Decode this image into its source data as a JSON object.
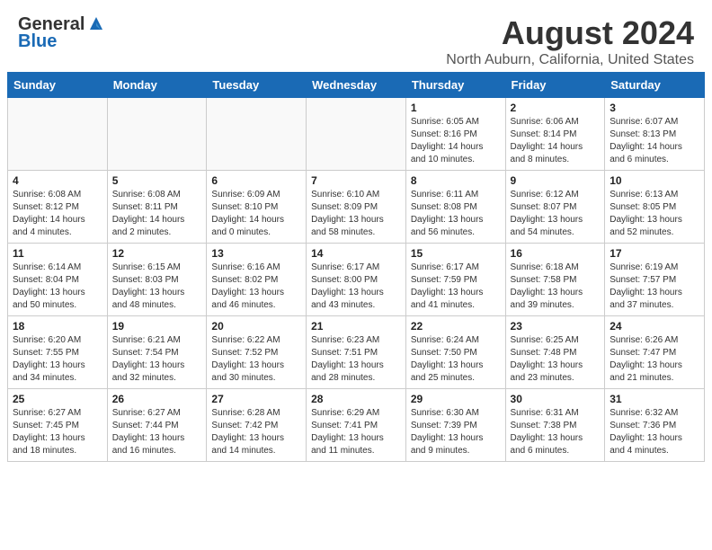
{
  "header": {
    "logo_line1": "General",
    "logo_line2": "Blue",
    "title": "August 2024",
    "subtitle": "North Auburn, California, United States"
  },
  "calendar": {
    "days_of_week": [
      "Sunday",
      "Monday",
      "Tuesday",
      "Wednesday",
      "Thursday",
      "Friday",
      "Saturday"
    ],
    "weeks": [
      [
        {
          "day": "",
          "info": ""
        },
        {
          "day": "",
          "info": ""
        },
        {
          "day": "",
          "info": ""
        },
        {
          "day": "",
          "info": ""
        },
        {
          "day": "1",
          "info": "Sunrise: 6:05 AM\nSunset: 8:16 PM\nDaylight: 14 hours\nand 10 minutes."
        },
        {
          "day": "2",
          "info": "Sunrise: 6:06 AM\nSunset: 8:14 PM\nDaylight: 14 hours\nand 8 minutes."
        },
        {
          "day": "3",
          "info": "Sunrise: 6:07 AM\nSunset: 8:13 PM\nDaylight: 14 hours\nand 6 minutes."
        }
      ],
      [
        {
          "day": "4",
          "info": "Sunrise: 6:08 AM\nSunset: 8:12 PM\nDaylight: 14 hours\nand 4 minutes."
        },
        {
          "day": "5",
          "info": "Sunrise: 6:08 AM\nSunset: 8:11 PM\nDaylight: 14 hours\nand 2 minutes."
        },
        {
          "day": "6",
          "info": "Sunrise: 6:09 AM\nSunset: 8:10 PM\nDaylight: 14 hours\nand 0 minutes."
        },
        {
          "day": "7",
          "info": "Sunrise: 6:10 AM\nSunset: 8:09 PM\nDaylight: 13 hours\nand 58 minutes."
        },
        {
          "day": "8",
          "info": "Sunrise: 6:11 AM\nSunset: 8:08 PM\nDaylight: 13 hours\nand 56 minutes."
        },
        {
          "day": "9",
          "info": "Sunrise: 6:12 AM\nSunset: 8:07 PM\nDaylight: 13 hours\nand 54 minutes."
        },
        {
          "day": "10",
          "info": "Sunrise: 6:13 AM\nSunset: 8:05 PM\nDaylight: 13 hours\nand 52 minutes."
        }
      ],
      [
        {
          "day": "11",
          "info": "Sunrise: 6:14 AM\nSunset: 8:04 PM\nDaylight: 13 hours\nand 50 minutes."
        },
        {
          "day": "12",
          "info": "Sunrise: 6:15 AM\nSunset: 8:03 PM\nDaylight: 13 hours\nand 48 minutes."
        },
        {
          "day": "13",
          "info": "Sunrise: 6:16 AM\nSunset: 8:02 PM\nDaylight: 13 hours\nand 46 minutes."
        },
        {
          "day": "14",
          "info": "Sunrise: 6:17 AM\nSunset: 8:00 PM\nDaylight: 13 hours\nand 43 minutes."
        },
        {
          "day": "15",
          "info": "Sunrise: 6:17 AM\nSunset: 7:59 PM\nDaylight: 13 hours\nand 41 minutes."
        },
        {
          "day": "16",
          "info": "Sunrise: 6:18 AM\nSunset: 7:58 PM\nDaylight: 13 hours\nand 39 minutes."
        },
        {
          "day": "17",
          "info": "Sunrise: 6:19 AM\nSunset: 7:57 PM\nDaylight: 13 hours\nand 37 minutes."
        }
      ],
      [
        {
          "day": "18",
          "info": "Sunrise: 6:20 AM\nSunset: 7:55 PM\nDaylight: 13 hours\nand 34 minutes."
        },
        {
          "day": "19",
          "info": "Sunrise: 6:21 AM\nSunset: 7:54 PM\nDaylight: 13 hours\nand 32 minutes."
        },
        {
          "day": "20",
          "info": "Sunrise: 6:22 AM\nSunset: 7:52 PM\nDaylight: 13 hours\nand 30 minutes."
        },
        {
          "day": "21",
          "info": "Sunrise: 6:23 AM\nSunset: 7:51 PM\nDaylight: 13 hours\nand 28 minutes."
        },
        {
          "day": "22",
          "info": "Sunrise: 6:24 AM\nSunset: 7:50 PM\nDaylight: 13 hours\nand 25 minutes."
        },
        {
          "day": "23",
          "info": "Sunrise: 6:25 AM\nSunset: 7:48 PM\nDaylight: 13 hours\nand 23 minutes."
        },
        {
          "day": "24",
          "info": "Sunrise: 6:26 AM\nSunset: 7:47 PM\nDaylight: 13 hours\nand 21 minutes."
        }
      ],
      [
        {
          "day": "25",
          "info": "Sunrise: 6:27 AM\nSunset: 7:45 PM\nDaylight: 13 hours\nand 18 minutes."
        },
        {
          "day": "26",
          "info": "Sunrise: 6:27 AM\nSunset: 7:44 PM\nDaylight: 13 hours\nand 16 minutes."
        },
        {
          "day": "27",
          "info": "Sunrise: 6:28 AM\nSunset: 7:42 PM\nDaylight: 13 hours\nand 14 minutes."
        },
        {
          "day": "28",
          "info": "Sunrise: 6:29 AM\nSunset: 7:41 PM\nDaylight: 13 hours\nand 11 minutes."
        },
        {
          "day": "29",
          "info": "Sunrise: 6:30 AM\nSunset: 7:39 PM\nDaylight: 13 hours\nand 9 minutes."
        },
        {
          "day": "30",
          "info": "Sunrise: 6:31 AM\nSunset: 7:38 PM\nDaylight: 13 hours\nand 6 minutes."
        },
        {
          "day": "31",
          "info": "Sunrise: 6:32 AM\nSunset: 7:36 PM\nDaylight: 13 hours\nand 4 minutes."
        }
      ]
    ]
  }
}
